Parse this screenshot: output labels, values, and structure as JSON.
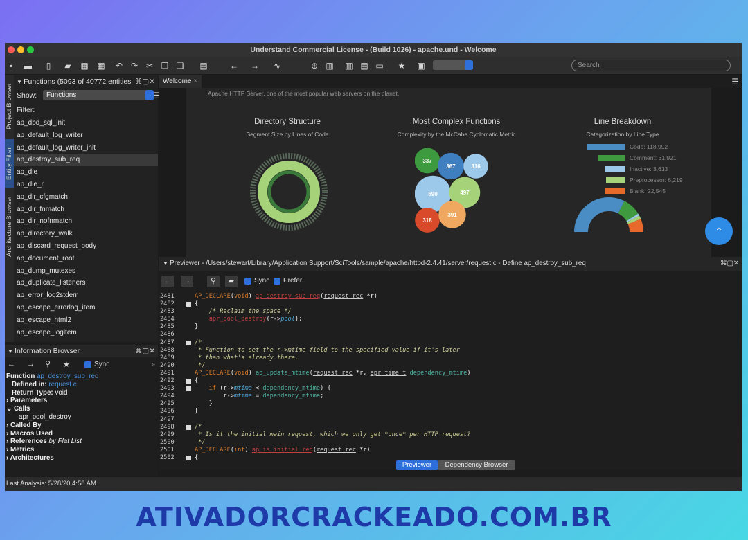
{
  "window": {
    "title": "Understand Commercial License - (Build 1026) - apache.und - Welcome"
  },
  "toolbar": {
    "search_placeholder": "Search"
  },
  "left_tabs": [
    "Project Browser",
    "Entity Filter",
    "Architecture Browser"
  ],
  "functions": {
    "header": "Functions (5093 of 40772 entities",
    "show_label": "Show:",
    "show_value": "Functions",
    "filter_label": "Filter:",
    "items": [
      "ap_dbd_sql_init",
      "ap_default_log_writer",
      "ap_default_log_writer_init",
      "ap_destroy_sub_req",
      "ap_die",
      "ap_die_r",
      "ap_dir_cfgmatch",
      "ap_dir_fnmatch",
      "ap_dir_nofnmatch",
      "ap_directory_walk",
      "ap_discard_request_body",
      "ap_document_root",
      "ap_dump_mutexes",
      "ap_duplicate_listeners",
      "ap_error_log2stderr",
      "ap_escape_errorlog_item",
      "ap_escape_html2",
      "ap_escape_logitem"
    ],
    "selected": "ap_destroy_sub_req"
  },
  "info": {
    "header": "Information Browser",
    "sync": "Sync",
    "function_label": "Function",
    "function_name": "ap_destroy_sub_req",
    "defined_label": "Defined in:",
    "defined_value": "request.c",
    "return_label": "Return Type:",
    "return_value": "void",
    "parameters": "Parameters",
    "calls": "Calls",
    "call_item": "apr_pool_destroy",
    "called_by": "Called By",
    "macros": "Macros Used",
    "references": "References",
    "flat_list": "by Flat List",
    "metrics": "Metrics",
    "architectures": "Architectures"
  },
  "welcome": {
    "tab": "Welcome",
    "description": "Apache HTTP Server, one of the most popular web servers on the planet.",
    "dir_title": "Directory Structure",
    "dir_sub": "Segment Size by Lines of Code",
    "complex_title": "Most Complex Functions",
    "complex_sub": "Complexity by the McCabe Cyclomatic Metric",
    "line_title": "Line Breakdown",
    "line_sub": "Categorization by Line Type"
  },
  "chart_data": [
    {
      "type": "bubble",
      "title": "Most Complex Functions",
      "values": [
        337,
        367,
        316,
        690,
        497,
        318,
        391
      ],
      "colors": [
        "#3e9a3e",
        "#3f7fc0",
        "#9cc8ea",
        "#9cc8ea",
        "#a6d27a",
        "#d84a2a",
        "#f0a860"
      ]
    },
    {
      "type": "pie",
      "title": "Line Breakdown",
      "categories": [
        "Code",
        "Comment",
        "Inactive",
        "Preprocessor",
        "Blank"
      ],
      "labels": [
        "Code: 118,992",
        "Comment: 31,921",
        "Inactive: 3,613",
        "Preprocessor: 6,219",
        "Blank: 22,545"
      ],
      "values": [
        118992,
        31921,
        3613,
        6219,
        22545
      ],
      "colors": [
        "#4a8cc4",
        "#3f9a3f",
        "#9cc8ea",
        "#a6d27a",
        "#e86a2a"
      ]
    }
  ],
  "previewer": {
    "title": "Previewer - /Users/stewart/Library/Application Support/SciTools/sample/apache/httpd-2.4.41/server/request.c - Define ap_destroy_sub_req",
    "sync": "Sync",
    "prefer": "Prefer"
  },
  "bottom_tabs": [
    "Previewer",
    "Dependency Browser"
  ],
  "status": "Last Analysis: 5/28/20 4:58 AM",
  "watermark": "ATIVADORCRACKEADO.COM.BR"
}
